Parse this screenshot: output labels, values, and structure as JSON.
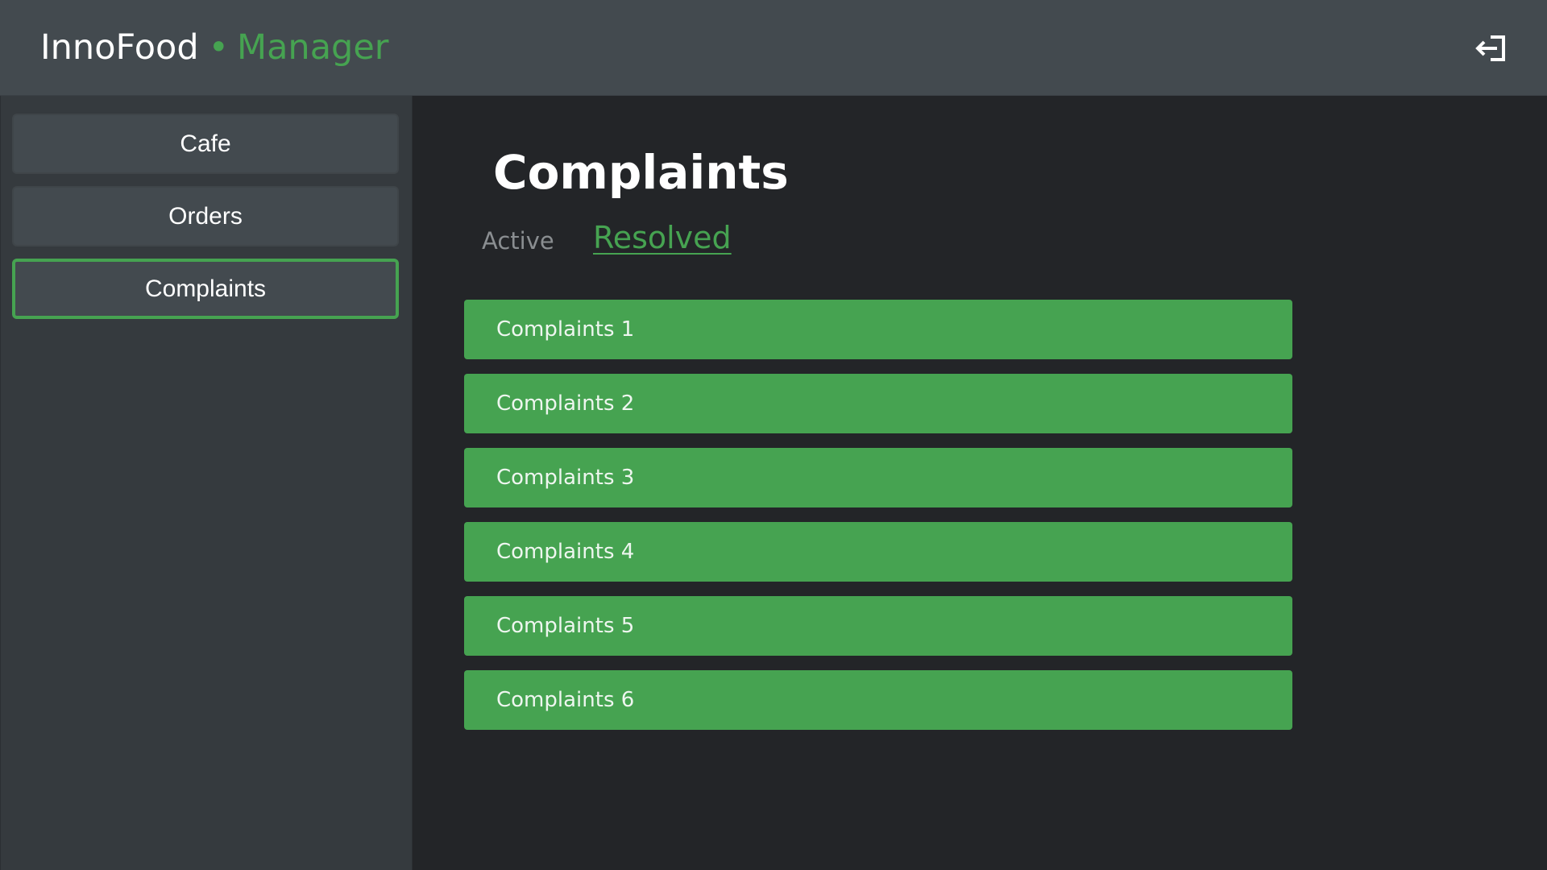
{
  "header": {
    "brand_name": "InnoFood",
    "brand_separator": "•",
    "brand_role": "Manager",
    "logout_icon": "logout-icon"
  },
  "sidebar": {
    "items": [
      {
        "label": "Cafe",
        "active": false
      },
      {
        "label": "Orders",
        "active": false
      },
      {
        "label": "Complaints",
        "active": true
      }
    ]
  },
  "main": {
    "title": "Complaints",
    "tabs": [
      {
        "label": "Active",
        "selected": false
      },
      {
        "label": "Resolved",
        "selected": true
      }
    ],
    "complaints": [
      {
        "label": "Complaints 1"
      },
      {
        "label": "Complaints 2"
      },
      {
        "label": "Complaints 3"
      },
      {
        "label": "Complaints 4"
      },
      {
        "label": "Complaints 5"
      },
      {
        "label": "Complaints 6"
      }
    ]
  },
  "colors": {
    "accent": "#46a351",
    "header_bg": "#434a4f",
    "sidebar_bg": "#353a3e",
    "main_bg": "#232528"
  }
}
